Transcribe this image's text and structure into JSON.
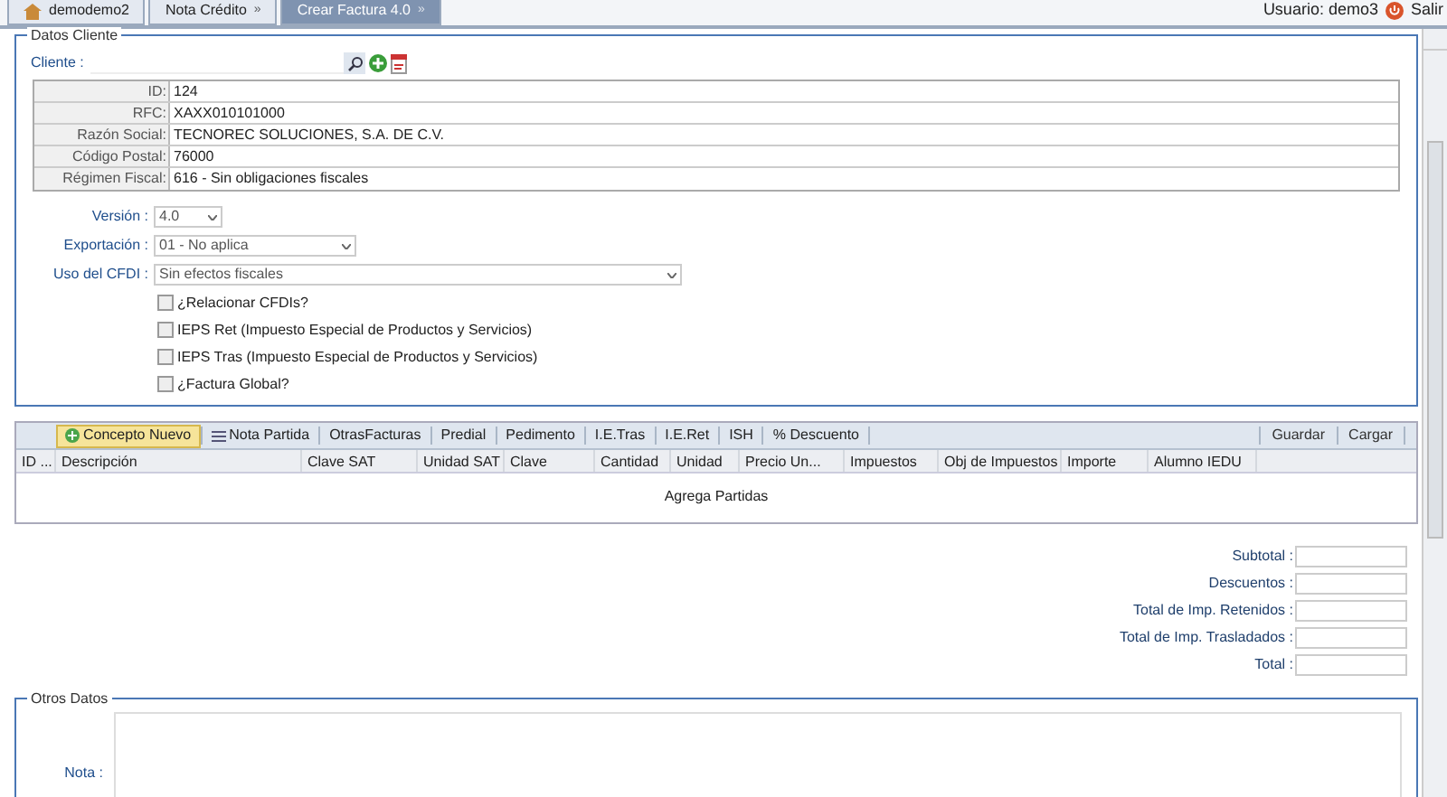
{
  "tabs": [
    {
      "label": "demodemo2",
      "kind": "home",
      "selected": false
    },
    {
      "label": "Nota Crédito",
      "kind": "plain",
      "selected": false,
      "close": "»"
    },
    {
      "label": "Crear Factura 4.0",
      "kind": "plain",
      "selected": true,
      "close": "»"
    }
  ],
  "user": {
    "label": "Usuario: demo3",
    "logout": "Salir"
  },
  "client_section": {
    "title": "Datos Cliente",
    "client_label": "Cliente :",
    "details": [
      {
        "label": "ID:",
        "value": "124"
      },
      {
        "label": "RFC:",
        "value": "XAXX010101000"
      },
      {
        "label": "Razón Social:",
        "value": "TECNOREC SOLUCIONES, S.A. DE C.V."
      },
      {
        "label": "Código Postal:",
        "value": "76000"
      },
      {
        "label": "Régimen Fiscal:",
        "value": "616 - Sin obligaciones fiscales"
      }
    ],
    "selects": [
      {
        "label": "Versión :",
        "value": "4.0"
      },
      {
        "label": "Exportación :",
        "value": "01 - No aplica"
      },
      {
        "label": "Uso del CFDI :",
        "value": "Sin efectos fiscales"
      }
    ],
    "options": [
      {
        "label": "¿Relacionar CFDIs?",
        "checked": false
      },
      {
        "label": "IEPS Ret (Impuesto Especial de Productos y Servicios)",
        "checked": false
      },
      {
        "label": "IEPS Tras (Impuesto Especial de Productos y Servicios)",
        "checked": false
      },
      {
        "label": "¿Factura Global?",
        "checked": false
      }
    ]
  },
  "toolbar": {
    "left": [
      {
        "label": "Concepto Nuevo",
        "kind": "add",
        "selected": true
      },
      {
        "label": "Nota Partida",
        "kind": "list",
        "selected": false
      },
      {
        "label": "OtrasFacturas",
        "kind": "plain",
        "selected": false
      },
      {
        "label": "Predial",
        "kind": "plain",
        "selected": false
      },
      {
        "label": "Pedimento",
        "kind": "plain",
        "selected": false
      },
      {
        "label": "I.E.Tras",
        "kind": "plain",
        "selected": false
      },
      {
        "label": "I.E.Ret",
        "kind": "plain",
        "selected": false
      },
      {
        "label": "ISH",
        "kind": "plain",
        "selected": false
      },
      {
        "label": "% Descuento",
        "kind": "plain",
        "selected": false
      }
    ],
    "right": [
      "Guardar",
      "Cargar"
    ]
  },
  "table": {
    "columns": [
      "ID ...",
      "Descripción",
      "Clave SAT",
      "Unidad SAT",
      "Clave",
      "Cantidad",
      "Unidad",
      "Precio Un...",
      "Impuestos",
      "Obj de Impuestos",
      "Importe",
      "Alumno IEDU"
    ],
    "empty_text": "Agrega Partidas"
  },
  "totals": [
    "Subtotal :",
    "Descuentos :",
    "Total de Imp. Retenidos :",
    "Total de Imp. Trasladados :",
    "Total :"
  ],
  "other_section": {
    "title": "Otros Datos",
    "note_label": "Nota :"
  }
}
